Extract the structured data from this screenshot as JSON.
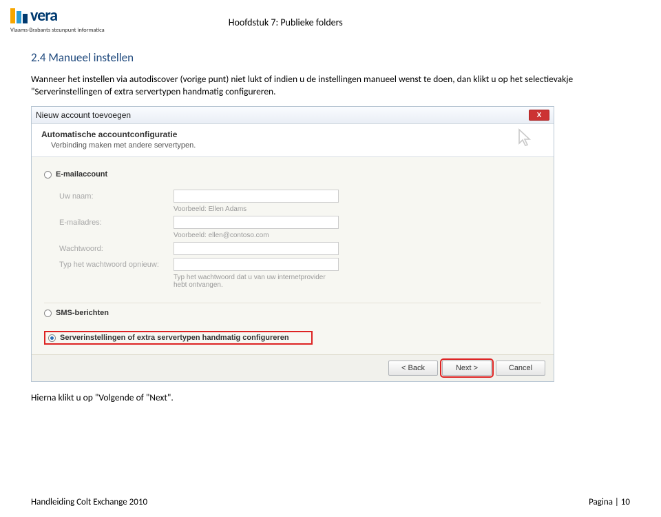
{
  "header": {
    "logo_text": "vera",
    "logo_subtitle": "Vlaams-Brabants steunpunt informatica",
    "chapter": "Hoofdstuk 7: Publieke folders"
  },
  "section": {
    "title": "2.4 Manueel instellen",
    "paragraph": "Wanneer het instellen via autodiscover (vorige punt) niet lukt of indien u de instellingen manueel wenst te doen, dan klikt u op het selectievakje \"Serverinstellingen of extra servertypen handmatig configureren."
  },
  "dialog": {
    "title": "Nieuw account toevoegen",
    "close_label": "X",
    "subhead_title": "Automatische accountconfiguratie",
    "subhead_desc": "Verbinding maken met andere servertypen.",
    "options": {
      "email": "E-mailaccount",
      "sms": "SMS-berichten",
      "server": "Serverinstellingen of extra servertypen handmatig configureren"
    },
    "fields": {
      "name_label": "Uw naam:",
      "name_hint": "Voorbeeld: Ellen Adams",
      "email_label": "E-mailadres:",
      "email_hint": "Voorbeeld: ellen@contoso.com",
      "pw_label": "Wachtwoord:",
      "pw2_label": "Typ het wachtwoord opnieuw:",
      "pw_hint": "Typ het wachtwoord dat u van uw internetprovider hebt ontvangen."
    },
    "buttons": {
      "back": "< Back",
      "next": "Next >",
      "cancel": "Cancel"
    }
  },
  "closing_para": "Hierna klikt u op \"Volgende of \"Next\".",
  "footer": {
    "left": "Handleiding Colt Exchange 2010",
    "right": "Pagina | 10"
  }
}
